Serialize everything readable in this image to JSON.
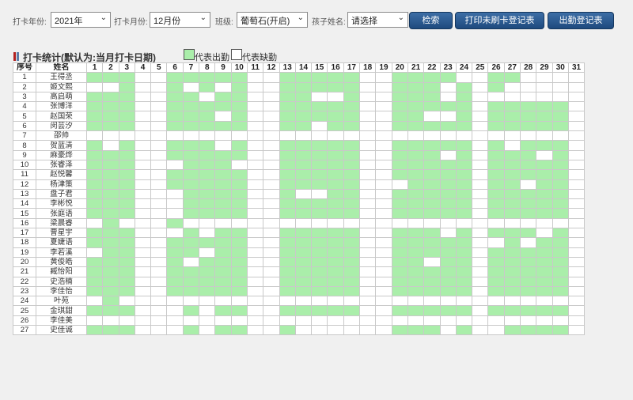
{
  "filters": {
    "year_label": "打卡年份:",
    "year_value": "2021年",
    "month_label": "打卡月份:",
    "month_value": "12月份",
    "class_label": "班级:",
    "class_value": "葡萄石(开启)",
    "child_label": "孩子姓名:",
    "child_value": "请选择"
  },
  "buttons": {
    "search": "检索",
    "print_unchecked": "打印未刷卡登记表",
    "attendance_register": "出勤登记表"
  },
  "section": {
    "title": "打卡统计(默认为:当月打卡日期)",
    "legend_present": "代表出勤",
    "legend_absent": "代表缺勤"
  },
  "colors": {
    "present": "#aaeeaa",
    "absent": "#ffffff",
    "button": "#2c5a8e"
  },
  "table": {
    "headers": [
      "序号",
      "姓名",
      "1",
      "2",
      "3",
      "4",
      "5",
      "6",
      "7",
      "8",
      "9",
      "10",
      "11",
      "12",
      "13",
      "14",
      "15",
      "16",
      "17",
      "18",
      "19",
      "20",
      "21",
      "22",
      "23",
      "24",
      "25",
      "26",
      "27",
      "28",
      "29",
      "30",
      "31"
    ],
    "rows": [
      {
        "no": "1",
        "name": "王得丞",
        "days": "1110011111001111100111100110000"
      },
      {
        "no": "2",
        "name": "姬文熙",
        "days": "0010010101001111100111010100000"
      },
      {
        "no": "3",
        "name": "高启萌",
        "days": "1110011011001100100111010000000"
      },
      {
        "no": "4",
        "name": "张博洋",
        "days": "1110011111001111100111110111110"
      },
      {
        "no": "5",
        "name": "赵国荣",
        "days": "1110011101001111100110010111110"
      },
      {
        "no": "6",
        "name": "闵芸汐",
        "days": "1110011111001101100111110111110"
      },
      {
        "no": "7",
        "name": "邵帅",
        "days": "0000000000000000000000000000000"
      },
      {
        "no": "8",
        "name": "贺蓝清",
        "days": "1010011101001111100111110101110"
      },
      {
        "no": "9",
        "name": "麻豪烨",
        "days": "1110011111001111100111010111010"
      },
      {
        "no": "10",
        "name": "张睿泽",
        "days": "1110001110001111100111110111110"
      },
      {
        "no": "11",
        "name": "赵悦馨",
        "days": "1110011111001111100111110111110"
      },
      {
        "no": "12",
        "name": "杨津策",
        "days": "1110011111001111100011110110110"
      },
      {
        "no": "13",
        "name": "盘子君",
        "days": "1110001111001001100111110111110"
      },
      {
        "no": "14",
        "name": "李彬悦",
        "days": "1110001111001111100111110111110"
      },
      {
        "no": "15",
        "name": "张庭语",
        "days": "1110001111001111100111110111110"
      },
      {
        "no": "16",
        "name": "梁晨睿",
        "days": "0100010000000000000000000000000"
      },
      {
        "no": "17",
        "name": "曹星宇",
        "days": "1110001011001111100111010111010"
      },
      {
        "no": "18",
        "name": "夏婕语",
        "days": "1110011111001111100111110010110"
      },
      {
        "no": "19",
        "name": "李若溪",
        "days": "0110011011001111100111110111110"
      },
      {
        "no": "20",
        "name": "黄俊皓",
        "days": "1110010111001111100110110111110"
      },
      {
        "no": "21",
        "name": "臧怡阳",
        "days": "1110011111001111100111110111110"
      },
      {
        "no": "22",
        "name": "史浩楠",
        "days": "1110011111001111100111110111110"
      },
      {
        "no": "23",
        "name": "李佳怡",
        "days": "1110011111001111100111110111110"
      },
      {
        "no": "24",
        "name": "叶苑",
        "days": "0100000000000000000000000000000"
      },
      {
        "no": "25",
        "name": "金琪甜",
        "days": "1110001011001111100111110111110"
      },
      {
        "no": "26",
        "name": "李佳美",
        "days": "0000000000000000000000000000000"
      },
      {
        "no": "27",
        "name": "史佳诚",
        "days": "1110001011001000000111010011110"
      }
    ]
  }
}
